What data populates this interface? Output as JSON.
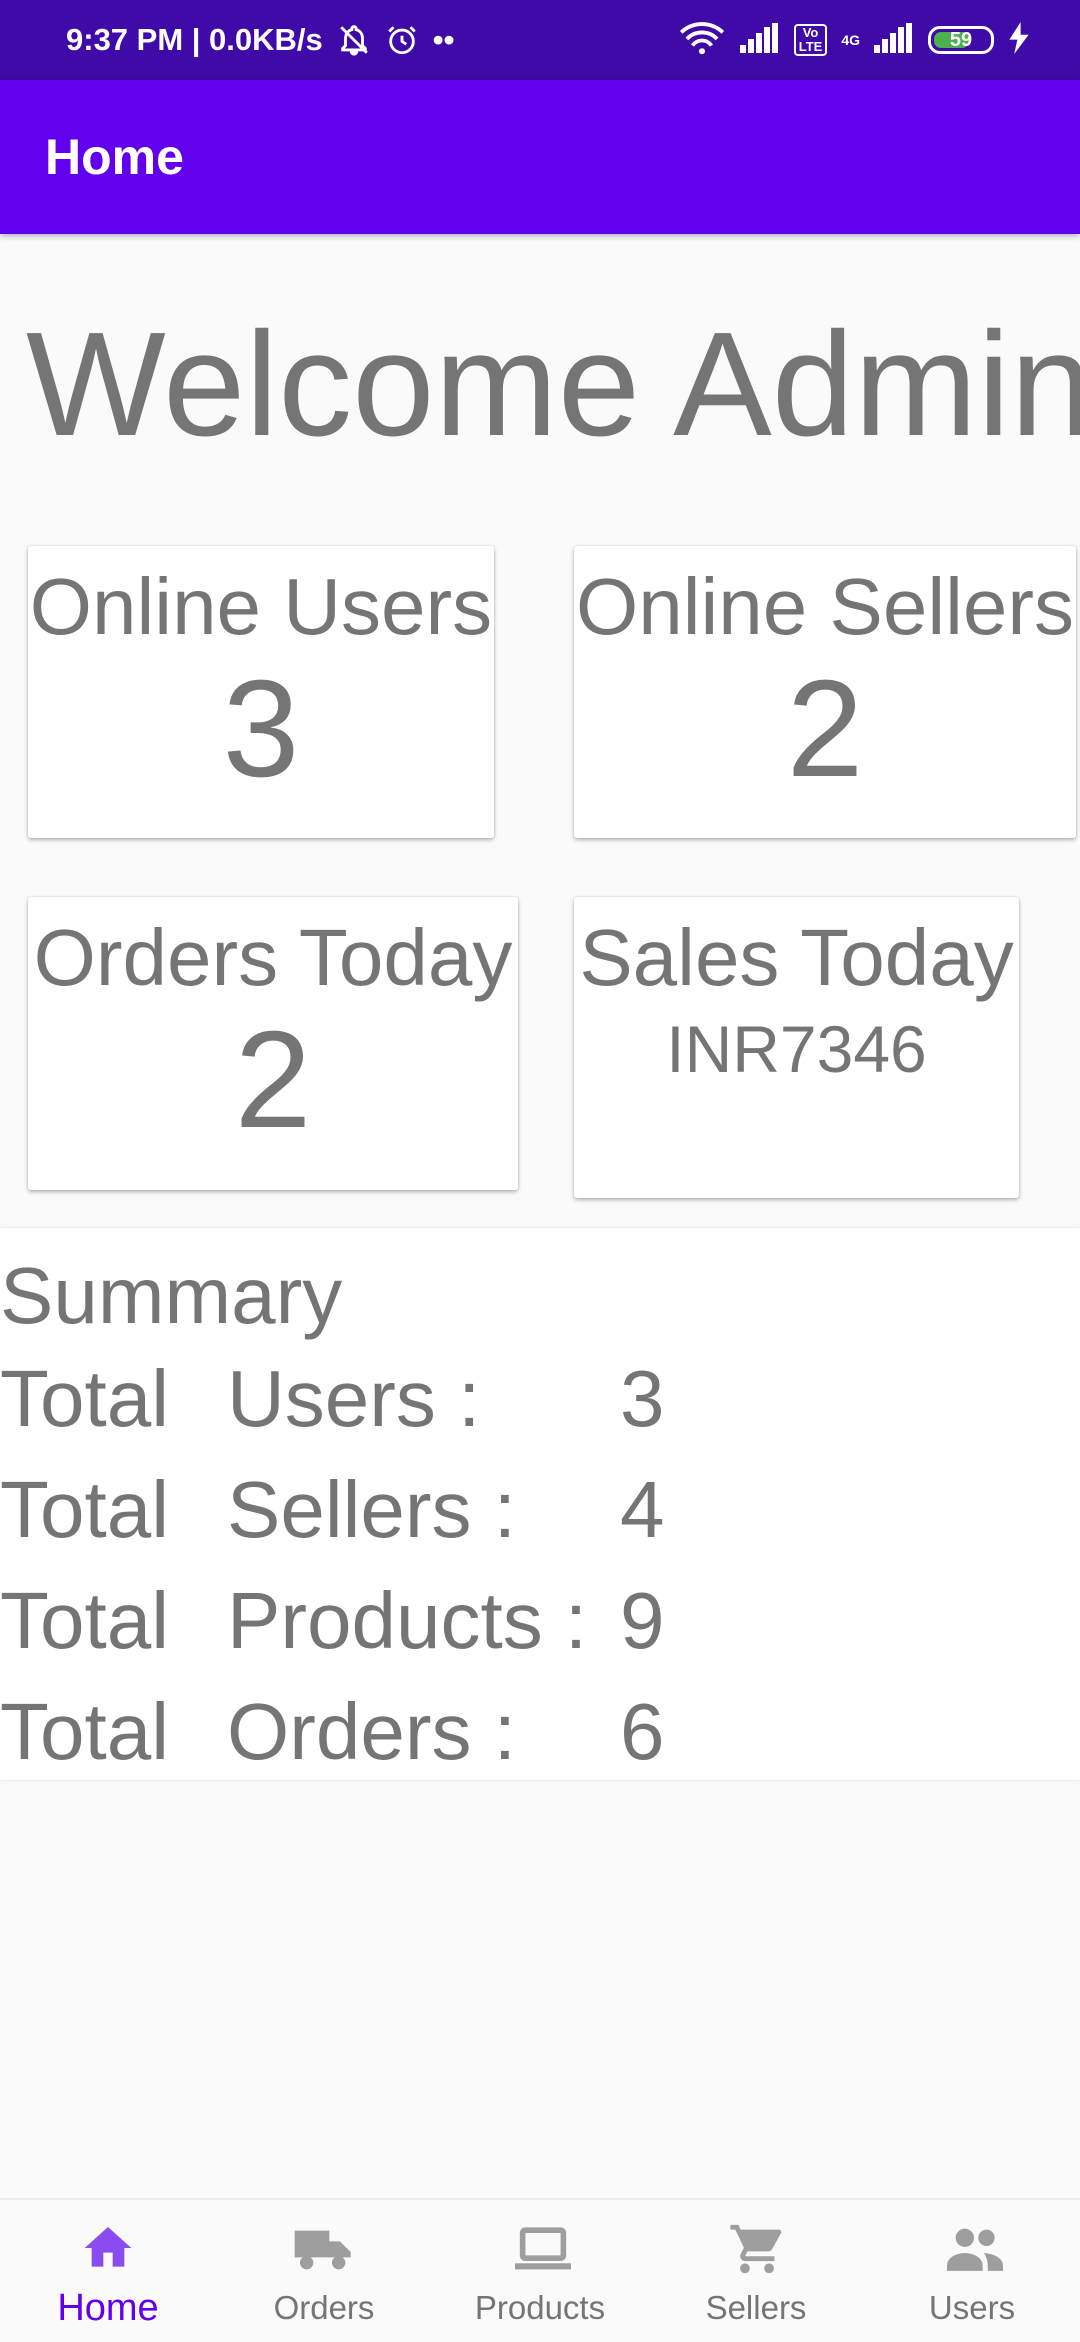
{
  "status_bar": {
    "time_speed": "9:37 PM | 0.0KB/s",
    "more_dots": "••",
    "volte": "Vo\nLTE",
    "network": "4G",
    "battery_level": "59"
  },
  "app_bar": {
    "title": "Home"
  },
  "welcome": "Welcome Admin",
  "cards": {
    "online_users": {
      "title": "Online Users",
      "value": "3"
    },
    "online_sellers": {
      "title": "Online Sellers",
      "value": "2"
    },
    "orders_today": {
      "title": "Orders Today",
      "value": "2"
    },
    "sales_today": {
      "title": "Sales Today",
      "value": "INR7346"
    }
  },
  "summary": {
    "heading": "Summary",
    "rows": [
      {
        "word1": "Total",
        "word2": "Users :",
        "value": "3"
      },
      {
        "word1": "Total",
        "word2": "Sellers :",
        "value": "4"
      },
      {
        "word1": "Total",
        "word2": "Products :",
        "value": "9"
      },
      {
        "word1": "Total",
        "word2": "Orders :",
        "value": "6"
      }
    ]
  },
  "bottom_nav": {
    "active": "Home",
    "items": [
      {
        "label": "Home",
        "icon": "home-icon"
      },
      {
        "label": "Orders",
        "icon": "truck-icon"
      },
      {
        "label": "Products",
        "icon": "laptop-icon"
      },
      {
        "label": "Sellers",
        "icon": "cart-icon"
      },
      {
        "label": "Users",
        "icon": "people-icon"
      }
    ]
  },
  "colors": {
    "primary": "#6200ee",
    "status_bar": "#3f0aa8",
    "text_gray": "#757575",
    "inactive_icon": "#9e9e9e",
    "active_icon": "#8a4cf0"
  }
}
